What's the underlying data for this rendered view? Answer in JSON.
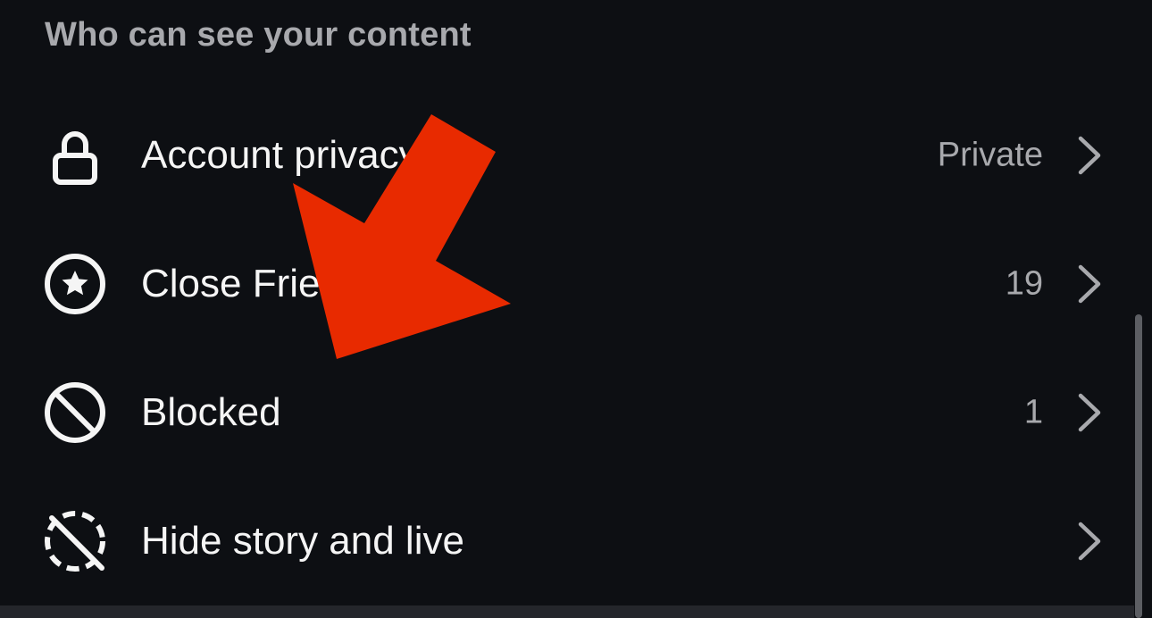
{
  "section": {
    "title": "Who can see your content"
  },
  "rows": [
    {
      "label": "Account privacy",
      "value": "Private",
      "icon": "lock-icon"
    },
    {
      "label": "Close Friends",
      "value": "19",
      "icon": "star-circle-icon"
    },
    {
      "label": "Blocked",
      "value": "1",
      "icon": "blocked-icon"
    },
    {
      "label": "Hide story and live",
      "value": "",
      "icon": "hide-story-icon"
    }
  ],
  "colors": {
    "background": "#0d0f13",
    "text": "#f5f5f5",
    "secondary_text": "#a8a9ad",
    "annotation_arrow": "#e82a00"
  }
}
